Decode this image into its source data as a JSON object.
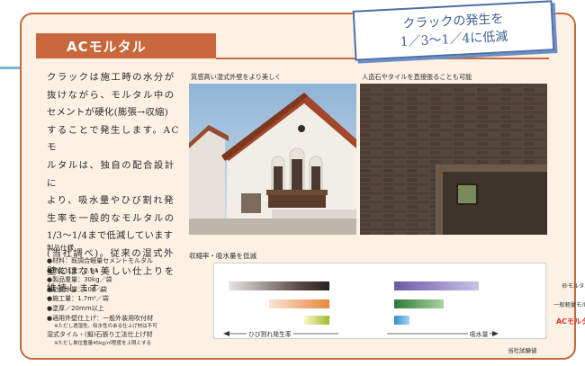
{
  "heading": "ACモルタル",
  "callout": {
    "line1": "クラックの発生を",
    "line2": "1／3～1／4に低減"
  },
  "body_lines": [
    "クラックは施工時の水分が",
    "抜けながら、モルタル中の",
    "セメントが硬化(膨張→収縮)",
    "することで発生します。ACモ",
    "ルタルは、独自の配合設計に",
    "より、吸水量やひび割れ発",
    "生率を一般的なモルタルの",
    "1/3～1/4まで低減しています",
    "(当社調べ)。従来の湿式外",
    "壁にはない美しい仕上りを",
    "維持します。"
  ],
  "spec_title": "製品仕様",
  "spec_items": [
    "●材料：既調合軽量セメントモルタル",
    "●絶乾比重：0.94",
    "●製品重量：30kg／袋",
    "●必要水量：10ℓ／袋",
    "●施工量：1.7m²／袋",
    "●塗厚／20mm以上",
    "●適用外壁仕上げ：一般外装用吹付材",
    "※ただし透湿性、吸水性のある仕上げ材は不可",
    "湿式タイル・(擬)石張り工法仕上げ材",
    "※ただし単位重量45kg/㎡程度を上限とする"
  ],
  "photo_left_caption": "質感高い湿式外壁をより美しく",
  "photo_right_caption": "人造石やタイルを直接張ることも可能",
  "chart_data": {
    "type": "bar",
    "title": "収縮率・吸水量を低減",
    "categories": [
      "砂モルタル",
      "一般軽量モルタル",
      "ACモルタル"
    ],
    "series": [
      {
        "name": "ひび割れ発生率",
        "values": [
          100,
          60,
          25
        ]
      },
      {
        "name": "吸水量",
        "values": [
          100,
          58,
          18
        ]
      }
    ],
    "left_axis_label": "ひび割れ発生率",
    "right_axis_label": "吸水量",
    "highlight_color": "#d8342c"
  },
  "source_note": "当社試験値"
}
